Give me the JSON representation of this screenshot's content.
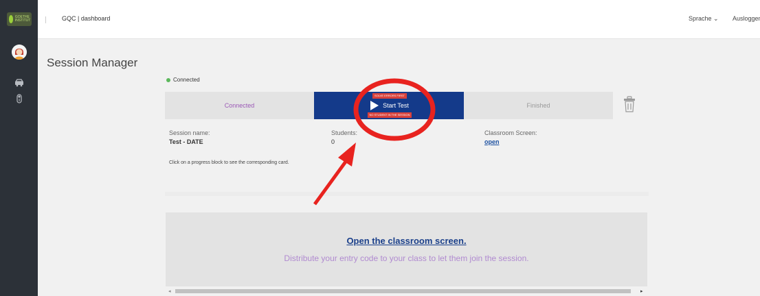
{
  "header": {
    "logo_text": "GOETHE INSTITUT",
    "breadcrumb": "GQC | dashboard",
    "language_menu": "Sprache",
    "language_chevron": "⌄",
    "logout": "Ausloggen"
  },
  "sidebar": {
    "avatar_icon": "user-avatar",
    "items": [
      {
        "icon": "car-icon"
      },
      {
        "icon": "toggle-icon"
      }
    ]
  },
  "page": {
    "title": "Session Manager",
    "connection_status": "Connected",
    "status_color": "#5cb85c"
  },
  "progress": {
    "segments": [
      {
        "label": "Connected",
        "state": "done"
      },
      {
        "label": "Start Test",
        "state": "active"
      },
      {
        "label": "Finished",
        "state": "pending"
      }
    ],
    "start_top_label": "SOLVE ERRORS FIRST",
    "start_bottom_label": "NO STUDENT IN THE SESSION",
    "accent_color": "#143a8a"
  },
  "session": {
    "name_label": "Session name:",
    "name_value": "Test - DATE",
    "students_label": "Students:",
    "students_value": "0",
    "classroom_label": "Classroom Screen:",
    "classroom_link": "open",
    "hint": "Click on a progress block to see the corresponding card."
  },
  "classroom_panel": {
    "link_text": "Open the classroom screen.",
    "subtitle": "Distribute your entry code to your class to let them join the session."
  },
  "scrollbar": {
    "left_arrow": "◂",
    "right_arrow": "▸"
  },
  "annotation": {
    "color": "#e8231f"
  }
}
